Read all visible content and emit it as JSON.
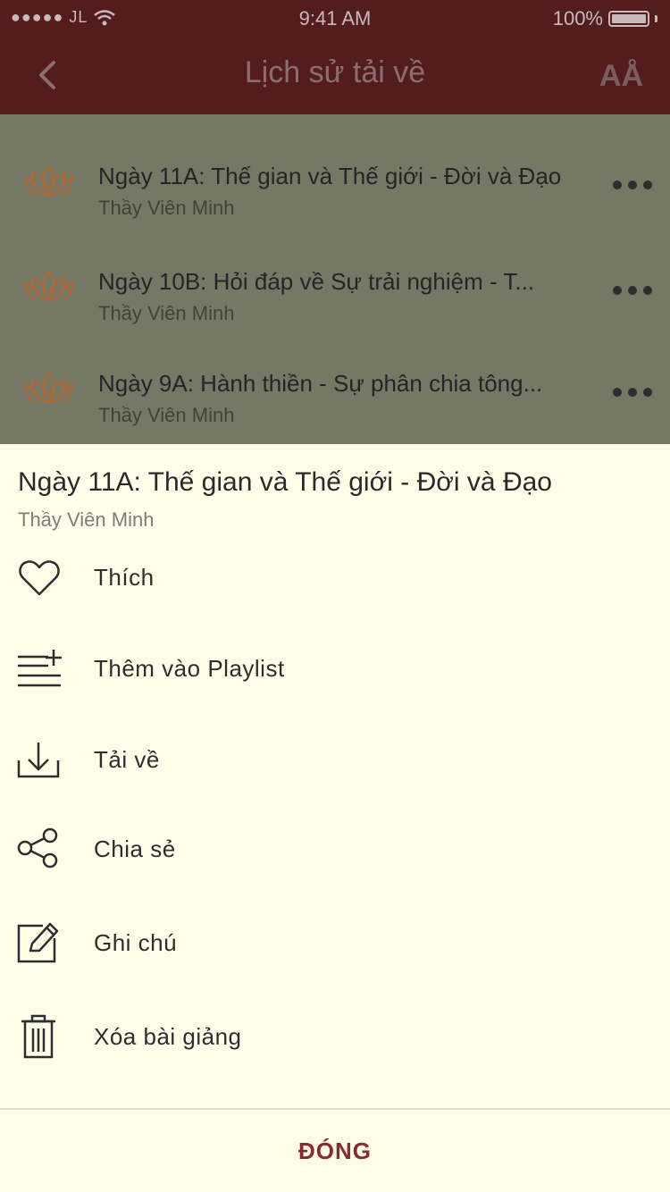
{
  "status_bar": {
    "signal": "●●●●● JL",
    "time": "9:41 AM",
    "battery": "100%"
  },
  "nav": {
    "title": "Lịch sử tải về",
    "font_button_label": "AÅ"
  },
  "list": [
    {
      "title": "Ngày 11A: Thế gian và Thế giới - Đời và Đạo",
      "author": "Thầy Viên Minh"
    },
    {
      "title": "Ngày 10B: Hỏi đáp về Sự trải nghiệm - T...",
      "author": "Thầy Viên Minh"
    },
    {
      "title": "Ngày 9A: Hành thiền - Sự phân chia tông...",
      "author": "Thầy Viên Minh"
    }
  ],
  "sheet": {
    "title": "Ngày 11A: Thế gian và Thế giới - Đời và Đạo",
    "author": "Thầy Viên Minh",
    "actions": [
      {
        "label": "Thích",
        "icon": "heart-icon"
      },
      {
        "label": "Thêm vào Playlist",
        "icon": "playlist-add-icon"
      },
      {
        "label": "Tải về",
        "icon": "download-icon"
      },
      {
        "label": "Chia sẻ",
        "icon": "share-icon"
      },
      {
        "label": "Ghi chú",
        "icon": "note-edit-icon"
      },
      {
        "label": "Xóa bài giảng",
        "icon": "trash-icon"
      }
    ],
    "close_label": "ĐÓNG"
  },
  "colors": {
    "nav_background": "#541d1d",
    "sheet_background": "#fefee9",
    "close_text": "#8a2a33",
    "lotus": "#a86a3a"
  }
}
